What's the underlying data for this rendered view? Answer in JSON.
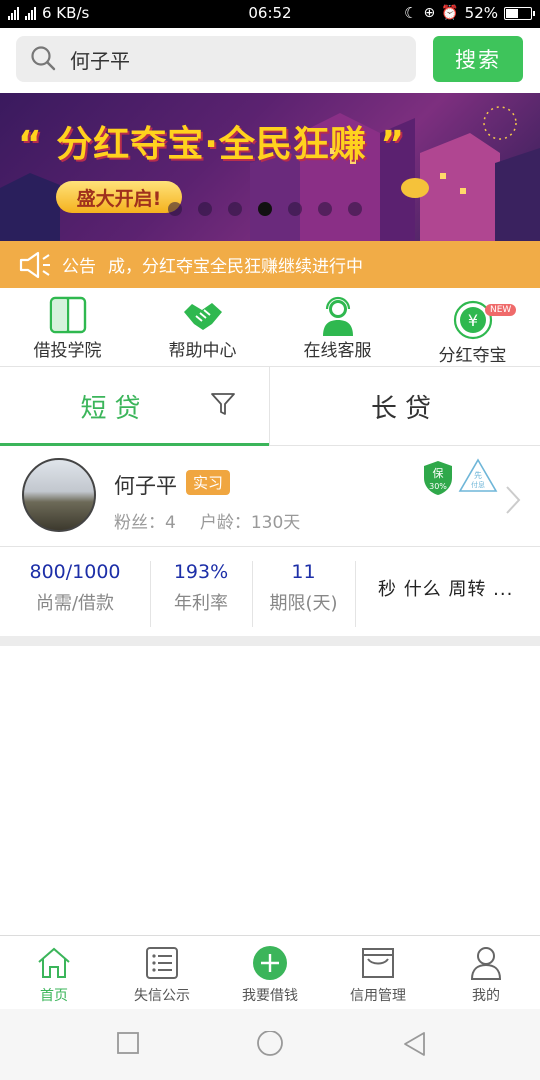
{
  "status_bar": {
    "network_text": "6 KB/s",
    "time": "06:52",
    "battery_percent": "52%",
    "battery_level": 0.52
  },
  "search": {
    "value": "何子平",
    "button_label": "搜索"
  },
  "banner": {
    "headline": "“ 分红夺宝·全民狂赚 ”",
    "cta_label": "盛大开启!",
    "slide_count": 7,
    "active_slide_index": 3
  },
  "notice": {
    "label": "公告",
    "text": "成，分红夺宝全民狂赚继续进行中"
  },
  "quick_nav": {
    "items": [
      {
        "label": "借投学院",
        "icon": "book-icon"
      },
      {
        "label": "帮助中心",
        "icon": "handshake-icon"
      },
      {
        "label": "在线客服",
        "icon": "customer-service-icon"
      },
      {
        "label": "分红夺宝",
        "icon": "yuan-coin-icon",
        "badge": "NEW"
      }
    ]
  },
  "tabs": {
    "short_label": "短贷",
    "long_label": "长贷",
    "active": "short"
  },
  "loan": {
    "user_name": "何子平",
    "tag": "实习",
    "fans_label": "粉丝：",
    "fans_value": "4",
    "age_label": "户龄：",
    "age_value": "130天",
    "badge_guarantee_top": "保",
    "badge_guarantee_bottom": "30%",
    "badge_prepay_top": "先",
    "badge_prepay_bottom": "付息",
    "amount_value": "800/1000",
    "amount_label": "尚需/借款",
    "rate_value": "193%",
    "rate_label": "年利率",
    "term_value": "11",
    "term_label": "期限(天)",
    "description": "秒 什么 周转 ..."
  },
  "bottom_nav": {
    "items": [
      {
        "label": "首页",
        "icon": "home-icon",
        "active": true
      },
      {
        "label": "失信公示",
        "icon": "list-icon",
        "active": false
      },
      {
        "label": "我要借钱",
        "icon": "plus-circle-icon",
        "active": false
      },
      {
        "label": "信用管理",
        "icon": "inbox-icon",
        "active": false
      },
      {
        "label": "我的",
        "icon": "user-icon",
        "active": false
      }
    ]
  },
  "colors": {
    "accent_green": "#3ec45b",
    "notice_orange": "#f1ac47",
    "stat_blue": "#1d2fa8",
    "tag_orange": "#f0a640"
  }
}
